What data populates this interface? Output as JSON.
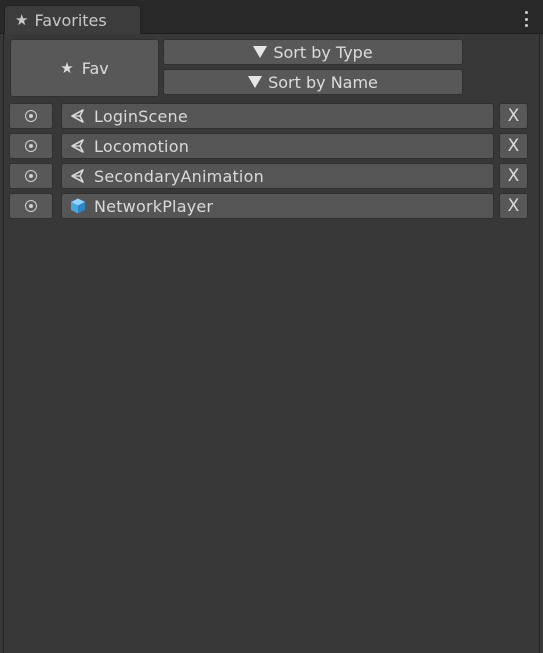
{
  "window": {
    "tab_title": "Favorites",
    "tab_icon": "star-icon"
  },
  "toolbar": {
    "fav_label": "Fav",
    "fav_icon": "star-icon",
    "sort_type_label": "Sort by Type",
    "sort_name_label": "Sort by Name"
  },
  "favorites": [
    {
      "name": "LoginScene",
      "icon": "unity-scene-icon",
      "ping_icon": "target-icon",
      "remove_label": "X"
    },
    {
      "name": "Locomotion",
      "icon": "unity-scene-icon",
      "ping_icon": "target-icon",
      "remove_label": "X"
    },
    {
      "name": "SecondaryAnimation",
      "icon": "unity-scene-icon",
      "ping_icon": "target-icon",
      "remove_label": "X"
    },
    {
      "name": "NetworkPlayer",
      "icon": "prefab-cube-icon",
      "ping_icon": "target-icon",
      "remove_label": "X"
    }
  ],
  "colors": {
    "background": "#383838",
    "button": "#585858",
    "prefab_icon": "#5bb8f0"
  }
}
